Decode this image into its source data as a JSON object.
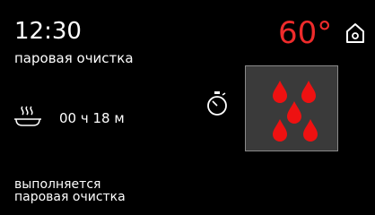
{
  "status_bar": {
    "time": "12:30",
    "temperature": "60°",
    "temperature_color": "#ee2b2b",
    "home_icon": "home-icon"
  },
  "program": {
    "name": "паровая очистка",
    "icon": "steam-pan-icon",
    "duration": "00 ч 18 м"
  },
  "timer_icon": "stopwatch-icon",
  "tile": {
    "icon": "water-drops-icon",
    "drop_color": "#ee1111",
    "background_color": "#3a3a3a"
  },
  "status_message": {
    "line1": "выполняется",
    "line2": "паровая очистка"
  }
}
